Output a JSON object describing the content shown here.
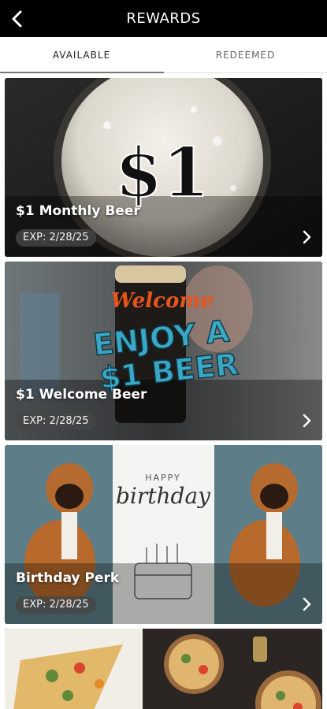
{
  "header": {
    "title": "REWARDS",
    "back_icon": "chevron-left-icon"
  },
  "tabs": [
    {
      "label": "AVAILABLE",
      "active": true
    },
    {
      "label": "REDEEMED",
      "active": false
    }
  ],
  "rewards": [
    {
      "title": "$1 Monthly Beer",
      "exp": "EXP: 2/28/25",
      "art_text": "$1"
    },
    {
      "title": "$1 Welcome Beer",
      "exp": "EXP: 2/28/25",
      "art_script": "Welcome",
      "art_line1": "ENJOY A",
      "art_line2": "$1 BEER"
    },
    {
      "title": "Birthday Perk",
      "exp": "EXP: 2/28/25",
      "art_small": "HAPPY",
      "art_script": "birthday"
    },
    {
      "title": "",
      "exp": ""
    }
  ],
  "colors": {
    "header_bg": "#000000",
    "accent_orange": "#e8531e",
    "accent_teal": "#3aa7c4"
  }
}
